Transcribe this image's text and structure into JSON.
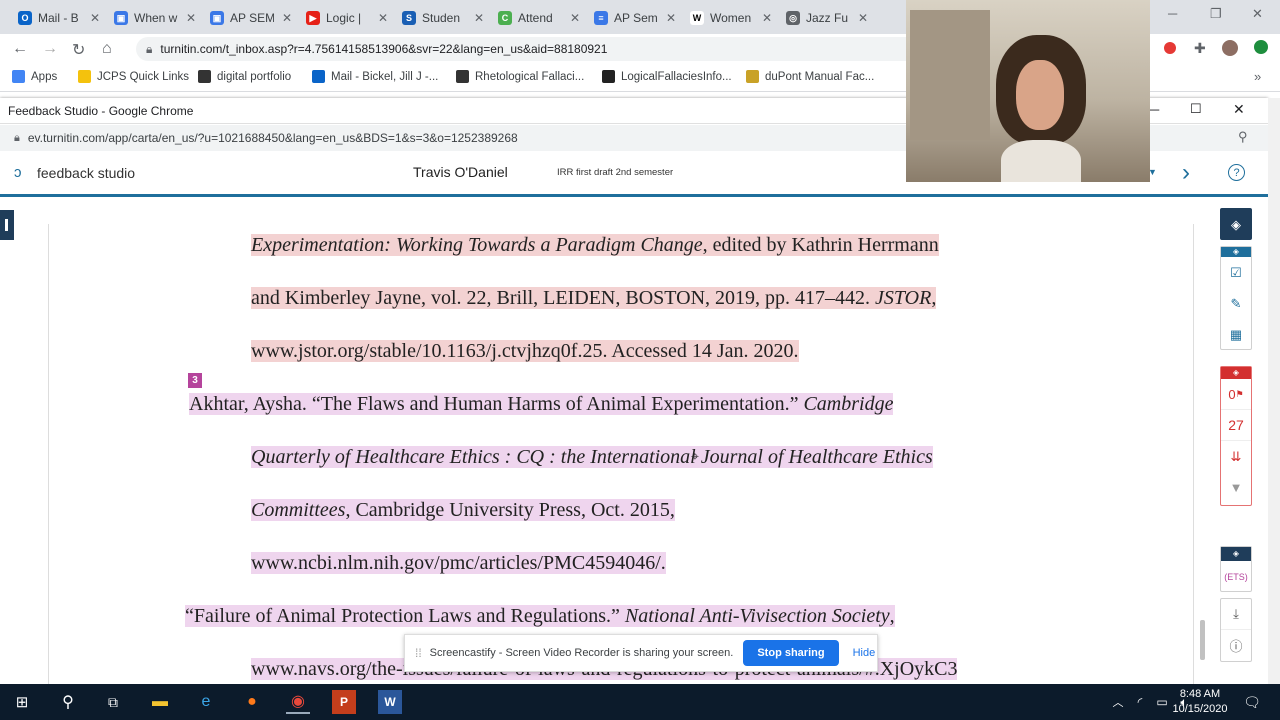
{
  "browser": {
    "tabs": [
      {
        "title": "Mail - B",
        "color": "#0a64c8",
        "glyph": "O"
      },
      {
        "title": "When w",
        "color": "#3b78e7",
        "glyph": "▣"
      },
      {
        "title": "AP SEM",
        "color": "#3b78e7",
        "glyph": "▣"
      },
      {
        "title": "Logic |",
        "color": "#e62117",
        "glyph": "▶"
      },
      {
        "title": "Studen",
        "color": "#1a5fb4",
        "glyph": "S"
      },
      {
        "title": "Attend",
        "color": "#4caf50",
        "glyph": "C"
      },
      {
        "title": "AP Sem",
        "color": "#3b78e7",
        "glyph": "≡"
      },
      {
        "title": "Women",
        "color": "#ffffff",
        "glyph": "W"
      },
      {
        "title": "Jazz Fu",
        "color": "#5f6368",
        "glyph": "◎"
      }
    ],
    "address": "turnitin.com/t_inbox.asp?r=4.75614158513906&svr=22&lang=en_us&aid=88180921",
    "bookmarks": [
      {
        "label": "Apps",
        "color": "#4285f4"
      },
      {
        "label": "JCPS Quick Links",
        "color": "#f4c20d"
      },
      {
        "label": "digital portfolio",
        "color": "#333"
      },
      {
        "label": "Mail - Bickel, Jill J -...",
        "color": "#0a64c8"
      },
      {
        "label": "Rhetological Fallaci...",
        "color": "#333"
      },
      {
        "label": "LogicalFallaciesInfo...",
        "color": "#222"
      },
      {
        "label": "duPont Manual Fac...",
        "color": "#c9a227"
      }
    ]
  },
  "popup": {
    "title": "Feedback Studio - Google Chrome",
    "address": "ev.turnitin.com/app/carta/en_us/?u=1021688450&lang=en_us&BDS=1&s=3&o=1252389268",
    "brand": "feedback studio",
    "student": "Travis O'Daniel",
    "assignment": "IRR first draft 2nd semester"
  },
  "document": {
    "lines": [
      {
        "parts": [
          {
            "t": "Experimentation: Working Towards a Paradigm Change",
            "i": true
          },
          {
            "t": ", edited by Kathrin Herrmann",
            "i": false
          }
        ],
        "hl": "pink"
      },
      {
        "parts": [
          {
            "t": "and Kimberley Jayne, vol. 22, Brill, LEIDEN, BOSTON, 2019, pp. 417–442. ",
            "i": false
          },
          {
            "t": "JSTOR",
            "i": true
          },
          {
            "t": ",",
            "i": false
          }
        ],
        "hl": "pink"
      },
      {
        "parts": [
          {
            "t": "www.jstor.org/stable/10.1163/j.ctvjhzq0f.25. Accessed 14 Jan. 2020.",
            "i": false
          }
        ],
        "hl": "pink"
      },
      {
        "parts": [
          {
            "t": "Akhtar, Aysha. “The Flaws and Human Harms of Animal Experimentation.” ",
            "i": false
          },
          {
            "t": "Cambridge",
            "i": true
          }
        ],
        "hl": "purp"
      },
      {
        "parts": [
          {
            "t": "Quarterly of Healthcare Ethics : CQ : the International Journal of Healthcare Ethics",
            "i": true
          }
        ],
        "hl": "purp"
      },
      {
        "parts": [
          {
            "t": "Committees",
            "i": true
          },
          {
            "t": ", Cambridge University Press, Oct. 2015,",
            "i": false
          }
        ],
        "hl": "purp"
      },
      {
        "parts": [
          {
            "t": "www.ncbi.nlm.nih.gov/pmc/articles/PMC4594046/.",
            "i": false
          }
        ],
        "hl": "purp"
      },
      {
        "parts": [
          {
            "t": "“Failure of Animal Protection Laws and Regulations.” ",
            "i": false
          },
          {
            "t": "National Anti-Vivisection",
            "i": true
          },
          {
            "t": " Society",
            "i": true
          },
          {
            "t": ",",
            "i": false
          }
        ],
        "hl": "purp"
      },
      {
        "parts": [
          {
            "t": "www.navs.org/the-issues/failure-of-laws-and-regulations-to-protect-animals/#.XjOykC3",
            "i": false
          }
        ],
        "hl": "purp"
      }
    ],
    "marker": "3"
  },
  "sidebar": {
    "flag_count": "0",
    "score": "27"
  },
  "share_banner": {
    "message": "Screencastify - Screen Video Recorder is sharing your screen.",
    "stop_label": "Stop sharing",
    "hide_label": "Hide"
  },
  "taskbar": {
    "time": "8:48 AM",
    "date": "10/15/2020"
  },
  "colors": {
    "pink_highlight": "#f3d2d2",
    "purple_highlight": "#efd5ee",
    "turnitin_blue": "#1f6f9c",
    "red_tool": "#d32f2f"
  }
}
